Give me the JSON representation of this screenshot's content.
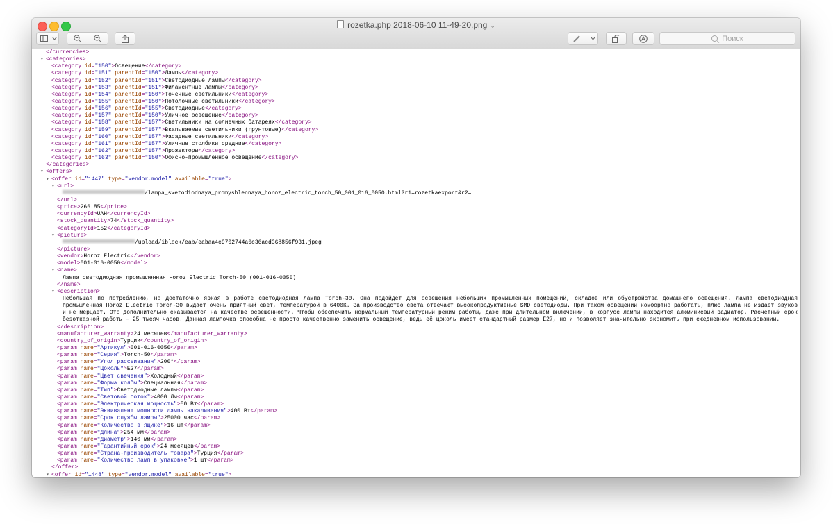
{
  "window": {
    "title": "rozetka.php 2018-06-10 11-49-20.png",
    "search_placeholder": "Поиск"
  },
  "toolbar": {
    "icons": [
      "sidebar-icon",
      "chevron-down-icon",
      "zoom-out-icon",
      "zoom-in-icon",
      "share-icon",
      "markup-pen-icon",
      "chevron-down-icon",
      "rotate-icon",
      "annotate-icon",
      "search-icon"
    ]
  },
  "xml": {
    "currencies_close": "</currencies>",
    "categories_open": "<categories>",
    "categories_close": "</categories>",
    "categories": [
      {
        "id": "150",
        "parent": "",
        "name": "Освещение"
      },
      {
        "id": "151",
        "parent": "150",
        "name": "Лампы"
      },
      {
        "id": "152",
        "parent": "151",
        "name": "Светодиодные лампы"
      },
      {
        "id": "153",
        "parent": "151",
        "name": "Филаментные лампы"
      },
      {
        "id": "154",
        "parent": "150",
        "name": "Точечные светильники"
      },
      {
        "id": "155",
        "parent": "150",
        "name": "Потолочные светильники"
      },
      {
        "id": "156",
        "parent": "155",
        "name": "Светодиодные"
      },
      {
        "id": "157",
        "parent": "150",
        "name": "Уличное освещение"
      },
      {
        "id": "158",
        "parent": "157",
        "name": "Светильники на солнечных батареях"
      },
      {
        "id": "159",
        "parent": "157",
        "name": "Вкапываемые светильники (грунтовые)"
      },
      {
        "id": "160",
        "parent": "157",
        "name": "Фасадные светильники"
      },
      {
        "id": "161",
        "parent": "157",
        "name": "Уличные столбики средние"
      },
      {
        "id": "162",
        "parent": "157",
        "name": "Прожекторы"
      },
      {
        "id": "163",
        "parent": "150",
        "name": "Офисно-промышленное освещение"
      }
    ],
    "offers_open": "<offers>",
    "offer": {
      "id": "1447",
      "type": "vendor.model",
      "available": "true",
      "url": "/lampa_svetodiodnaya_promyshlennaya_horoz_electric_torch_50_001_016_0050.html?r1=rozetkaexport&r2=",
      "price": "266.85",
      "currencyId": "UAH",
      "stock_quantity": "74",
      "categoryId": "152",
      "picture": "/upload/iblock/eab/eabaa4c9702744a6c36acd368856f931.jpeg",
      "vendor": "Horoz Electric",
      "model": "001-016-0050",
      "name": "Лампа светодиодная промышленная Horoz Electric Torch-50 (001-016-0050)",
      "description": "Небольшая по потреблению, но достаточно яркая в работе светодиодная лампа Torch-30. Она подойдет для освещения небольших промышленных помещений, складов или обустройства домашнего освещения. Лампа светодиодная промышленная Horoz Electric Torch-30 выдаёт очень приятный свет, температурой в 6400К. За производство света отвечают высокопродуктивные SMD светодиоды. При таком освещении комфортно работать, плюс лампа не издаёт звуков и не мерцает. Это дополнительно сказывается на качестве освещенности. Чтобы обеспечить нормальный температурный режим работы, даже при длительном включении, в корпусе лампы находится алюминиевый радиатор. Расчётный срок безотказной работы — 25 тысяч часов. Данная лампочка способна не просто качественно заменить освещение, ведь её цоколь имеет стандартный размер Е27, но и позволяет значительно экономить при ежедневном использовании.",
      "manufacturer_warranty": "24 месяцев",
      "country_of_origin": "Турции",
      "params": [
        {
          "name": "Артикул",
          "value": "001-016-0050"
        },
        {
          "name": "Серия",
          "value": "Torch-50"
        },
        {
          "name": "Угол рассеивания",
          "value": "200°"
        },
        {
          "name": "Цоколь",
          "value": "E27"
        },
        {
          "name": "Цвет свечения",
          "value": "Холодный"
        },
        {
          "name": "Форма колбы",
          "value": "Специальная"
        },
        {
          "name": "Тип",
          "value": "Светодиодные лампы"
        },
        {
          "name": "Световой поток",
          "value": "4000 Лм"
        },
        {
          "name": "Электрическая мощность",
          "value": "50 Вт"
        },
        {
          "name": "Эквивалент мощности лампы накаливания",
          "value": "400 Вт"
        },
        {
          "name": "Срок службы лампы",
          "value": "25000 час"
        },
        {
          "name": "Количество в ящике",
          "value": "16 шт"
        },
        {
          "name": "Длина",
          "value": "254 мм"
        },
        {
          "name": "Диаметр",
          "value": "140 мм"
        },
        {
          "name": "Гарантийный срок",
          "value": "24 месяцев"
        },
        {
          "name": "Страна-производитель товара",
          "value": "Турция"
        },
        {
          "name": "Количество ламп в упаковке",
          "value": "1 шт"
        }
      ]
    },
    "next_offer": {
      "id": "1448",
      "type": "vendor.model",
      "available": "true"
    }
  }
}
